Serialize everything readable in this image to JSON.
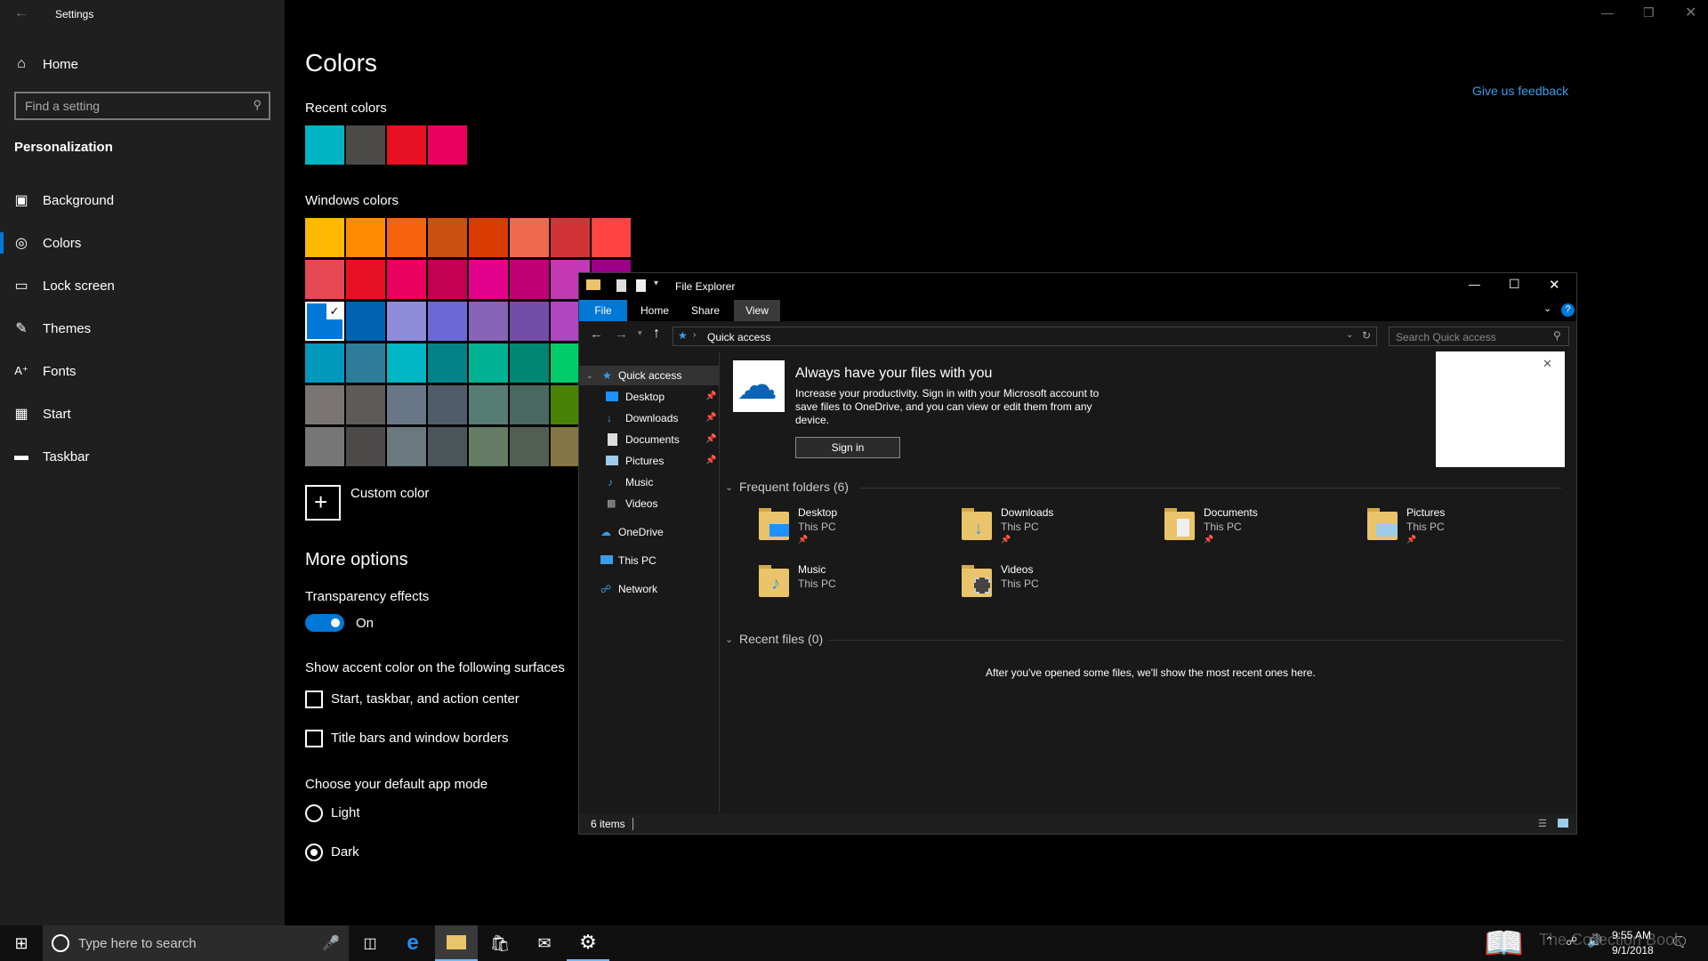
{
  "settings": {
    "window_title": "Settings",
    "home_label": "Home",
    "search_placeholder": "Find a setting",
    "section_title": "Personalization",
    "nav": [
      {
        "label": "Background",
        "icon": "picture-icon"
      },
      {
        "label": "Colors",
        "icon": "palette-icon"
      },
      {
        "label": "Lock screen",
        "icon": "lock-screen-icon"
      },
      {
        "label": "Themes",
        "icon": "brush-icon"
      },
      {
        "label": "Fonts",
        "icon": "font-icon"
      },
      {
        "label": "Start",
        "icon": "start-icon"
      },
      {
        "label": "Taskbar",
        "icon": "taskbar-icon"
      }
    ]
  },
  "colors": {
    "page_title": "Colors",
    "feedback_link": "Give us feedback",
    "recent_title": "Recent colors",
    "recent": [
      "#00b4c3",
      "#4c4a48",
      "#e81123",
      "#ea005e"
    ],
    "windows_title": "Windows colors",
    "grid": [
      [
        "#ffb900",
        "#ff8c00",
        "#f7630c",
        "#ca5010",
        "#da3b01",
        "#ef6950",
        "#d13438",
        "#ff4343"
      ],
      [
        "#e74856",
        "#e81123",
        "#ea005e",
        "#c30052",
        "#e3008c",
        "#bf0077",
        "#c239b3",
        "#9a0089"
      ],
      [
        "#0078d7",
        "#0063b1",
        "#8e8cd8",
        "#6b69d6",
        "#8764b8",
        "#744da9",
        "#b146c2",
        "#881798"
      ],
      [
        "#0099bc",
        "#2d7d9a",
        "#00b7c3",
        "#038387",
        "#00b294",
        "#018574",
        "#00cc6a",
        "#10893e"
      ],
      [
        "#7a7574",
        "#5d5a58",
        "#68768a",
        "#515c6b",
        "#567c73",
        "#486860",
        "#498205",
        "#107c10"
      ],
      [
        "#767676",
        "#4c4a48",
        "#69797e",
        "#4a5459",
        "#647c64",
        "#525e54",
        "#847545",
        "#7e735f"
      ]
    ],
    "custom_color_label": "Custom color",
    "more_options_title": "More options",
    "transparency_label": "Transparency effects",
    "transparency_state": "On",
    "accent_surfaces_title": "Show accent color on the following surfaces",
    "checkbox_start": "Start, taskbar, and action center",
    "checkbox_title_bars": "Title bars and window borders",
    "app_mode_title": "Choose your default app mode",
    "mode_light": "Light",
    "mode_dark": "Dark",
    "accent": "#0078d7"
  },
  "explorer": {
    "title": "File Explorer",
    "tabs": [
      "File",
      "Home",
      "Share",
      "View"
    ],
    "address": "Quick access",
    "search_placeholder": "Search Quick access",
    "tree": [
      {
        "label": "Quick access",
        "pinned": false
      },
      {
        "label": "Desktop",
        "pinned": true
      },
      {
        "label": "Downloads",
        "pinned": true
      },
      {
        "label": "Documents",
        "pinned": true
      },
      {
        "label": "Pictures",
        "pinned": true
      },
      {
        "label": "Music",
        "pinned": false
      },
      {
        "label": "Videos",
        "pinned": false
      }
    ],
    "tree_roots": [
      "OneDrive",
      "This PC",
      "Network"
    ],
    "banner_title": "Always have your files with you",
    "banner_text": "Increase your productivity. Sign in with your Microsoft account to save files to OneDrive, and you can view or edit them from any device.",
    "banner_button": "Sign in",
    "frequent_title": "Frequent folders (6)",
    "frequent": [
      {
        "name": "Desktop",
        "location": "This PC"
      },
      {
        "name": "Downloads",
        "location": "This PC"
      },
      {
        "name": "Documents",
        "location": "This PC"
      },
      {
        "name": "Pictures",
        "location": "This PC"
      },
      {
        "name": "Music",
        "location": "This PC"
      },
      {
        "name": "Videos",
        "location": "This PC"
      }
    ],
    "recent_title": "Recent files (0)",
    "recent_empty": "After you've opened some files, we'll show the most recent ones here.",
    "status": "6 items"
  },
  "taskbar": {
    "search_placeholder": "Type here to search",
    "time": "9:55 AM",
    "date": "9/1/2018",
    "watermark": "The Collection Book"
  }
}
